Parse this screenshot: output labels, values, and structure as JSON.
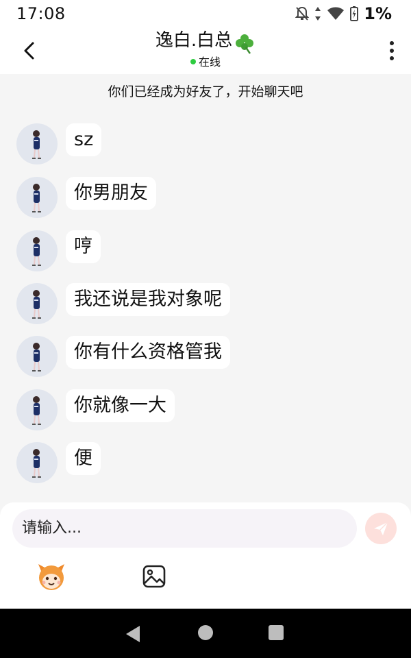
{
  "status_bar": {
    "time": "17:08",
    "battery_percent": "1%",
    "icons": [
      "notifications-off-icon",
      "data-arrows-icon",
      "wifi-icon",
      "battery-icon"
    ]
  },
  "header": {
    "title": "逸白.白总",
    "title_emoji": "clover-icon",
    "status": "在线",
    "status_color": "#2ecc40"
  },
  "chat": {
    "system_message": "你们已经成为好友了，开始聊天吧",
    "messages": [
      {
        "text": "sz"
      },
      {
        "text": "你男朋友"
      },
      {
        "text": "哼"
      },
      {
        "text": "我还说是我对象呢"
      },
      {
        "text": "你有什么资格管我"
      },
      {
        "text": "你就像一大"
      },
      {
        "text": "便"
      }
    ]
  },
  "composer": {
    "placeholder": "请输入...",
    "send_button_color": "#fde0dc"
  }
}
